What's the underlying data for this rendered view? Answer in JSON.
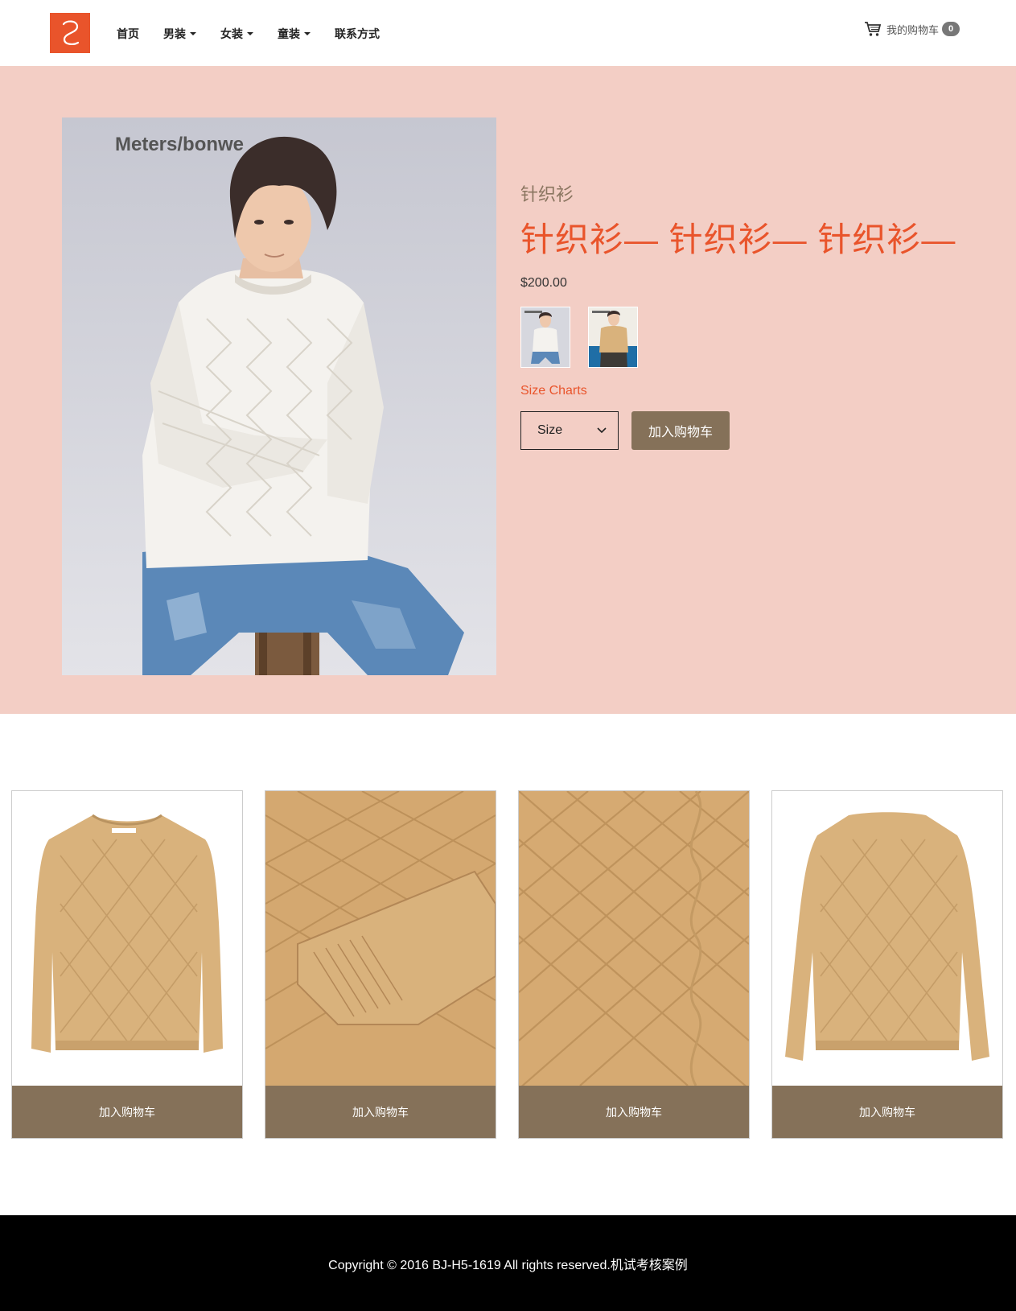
{
  "header": {
    "nav": [
      {
        "label": "首页",
        "has_caret": false
      },
      {
        "label": "男装",
        "has_caret": true
      },
      {
        "label": "女装",
        "has_caret": true
      },
      {
        "label": "童装",
        "has_caret": true
      },
      {
        "label": "联系方式",
        "has_caret": false
      }
    ],
    "cart_label": "我的购物车",
    "cart_count": "0"
  },
  "brand_text": "Meters/bonwe",
  "product": {
    "subtitle": "针织衫",
    "title": "针织衫— 针织衫— 针织衫—",
    "price": "$200.00",
    "thumbnails": [
      "white-sweater-thumb",
      "tan-sweater-thumb"
    ],
    "size_chart_label": "Size Charts",
    "size_select_value": "Size",
    "add_to_cart_label": "加入购物车"
  },
  "cards": [
    {
      "image": "tan-sweater-front",
      "button_label": "加入购物车"
    },
    {
      "image": "tan-sweater-sleeve-closeup",
      "button_label": "加入购物车"
    },
    {
      "image": "tan-sweater-knit-closeup",
      "button_label": "加入购物车"
    },
    {
      "image": "tan-sweater-back",
      "button_label": "加入购物车"
    }
  ],
  "footer": {
    "copyright": "Copyright © 2016 BJ-H5-1619 All rights reserved.机试考核案例"
  },
  "colors": {
    "accent": "#e9542b",
    "hero_bg": "#f3cec5",
    "button": "#857159",
    "sweater": "#d9b27c",
    "footer_bg": "#000000"
  }
}
